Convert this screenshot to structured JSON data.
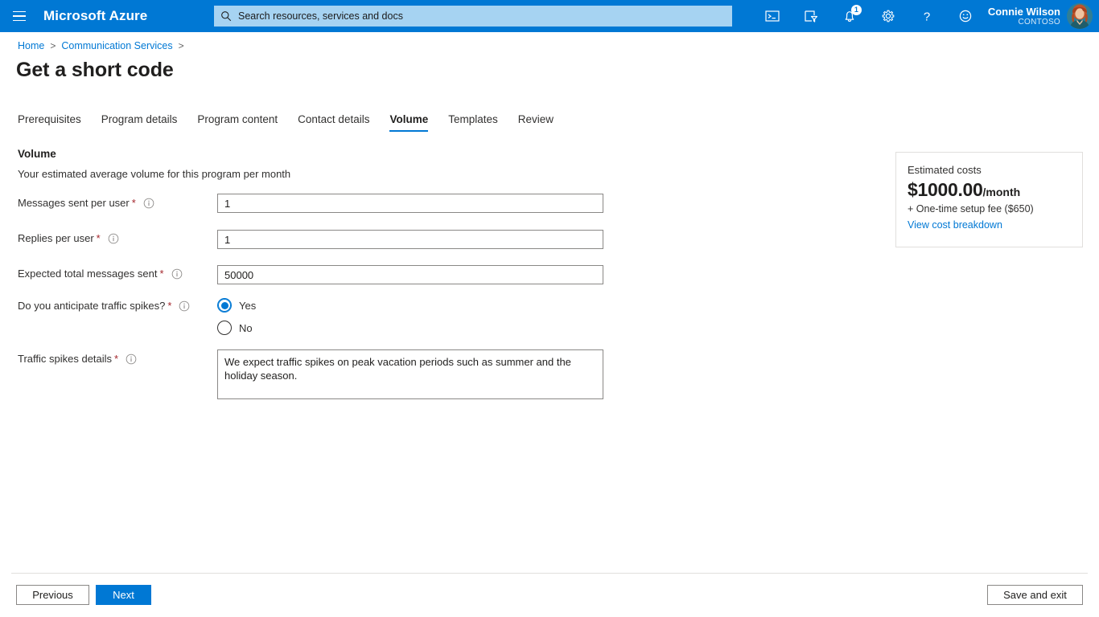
{
  "header": {
    "menu_icon": "hamburger-icon",
    "brand": "Microsoft Azure",
    "search": {
      "icon": "search-icon",
      "placeholder": "Search resources, services and docs"
    },
    "icons": [
      {
        "name": "cloud-shell-icon",
        "label": "Cloud Shell"
      },
      {
        "name": "directory-filter-icon",
        "label": "Directories + subscriptions"
      },
      {
        "name": "notifications-bell-icon",
        "label": "Notifications",
        "badge": "1"
      },
      {
        "name": "settings-gear-icon",
        "label": "Settings"
      },
      {
        "name": "help-question-icon",
        "label": "Help"
      },
      {
        "name": "feedback-smiley-icon",
        "label": "Feedback"
      }
    ],
    "account": {
      "name": "Connie Wilson",
      "org": "CONTOSO",
      "avatar": "user-avatar"
    },
    "accent_color": "#0078d4",
    "search_bg": "#a6d3f2"
  },
  "breadcrumb": {
    "items": [
      "Home",
      "Communication Services"
    ],
    "separator": ">"
  },
  "page": {
    "title": "Get a short code"
  },
  "tabs": [
    {
      "label": "Prerequisites",
      "active": false
    },
    {
      "label": "Program details",
      "active": false
    },
    {
      "label": "Program content",
      "active": false
    },
    {
      "label": "Contact details",
      "active": false
    },
    {
      "label": "Volume",
      "active": true
    },
    {
      "label": "Templates",
      "active": false
    },
    {
      "label": "Review",
      "active": false
    }
  ],
  "section": {
    "title": "Volume",
    "description": "Your estimated average volume for this program per month"
  },
  "form": {
    "messages_per_user": {
      "label": "Messages sent per user",
      "required": "*",
      "info_icon": "info-circle-icon",
      "value": "1"
    },
    "replies_per_user": {
      "label": "Replies per user",
      "required": "*",
      "info_icon": "info-circle-icon",
      "value": "1"
    },
    "expected_total": {
      "label": "Expected total messages sent",
      "required": "*",
      "info_icon": "info-circle-icon",
      "value": "50000"
    },
    "traffic_spikes": {
      "label": "Do you anticipate traffic spikes?",
      "required": "*",
      "info_icon": "info-circle-icon",
      "options": [
        {
          "label": "Yes",
          "selected": true
        },
        {
          "label": "No",
          "selected": false
        }
      ]
    },
    "spikes_details": {
      "label": "Traffic spikes details",
      "required": "*",
      "info_icon": "info-circle-icon",
      "value": "We expect traffic spikes on peak vacation periods such as summer and the holiday season."
    }
  },
  "cost_card": {
    "heading": "Estimated costs",
    "amount": "$1000.00",
    "period": "/month",
    "setup_fee": "+ One-time setup fee ($650)",
    "link": "View cost breakdown"
  },
  "footer": {
    "previous": "Previous",
    "next": "Next",
    "save_and_exit": "Save and exit"
  }
}
